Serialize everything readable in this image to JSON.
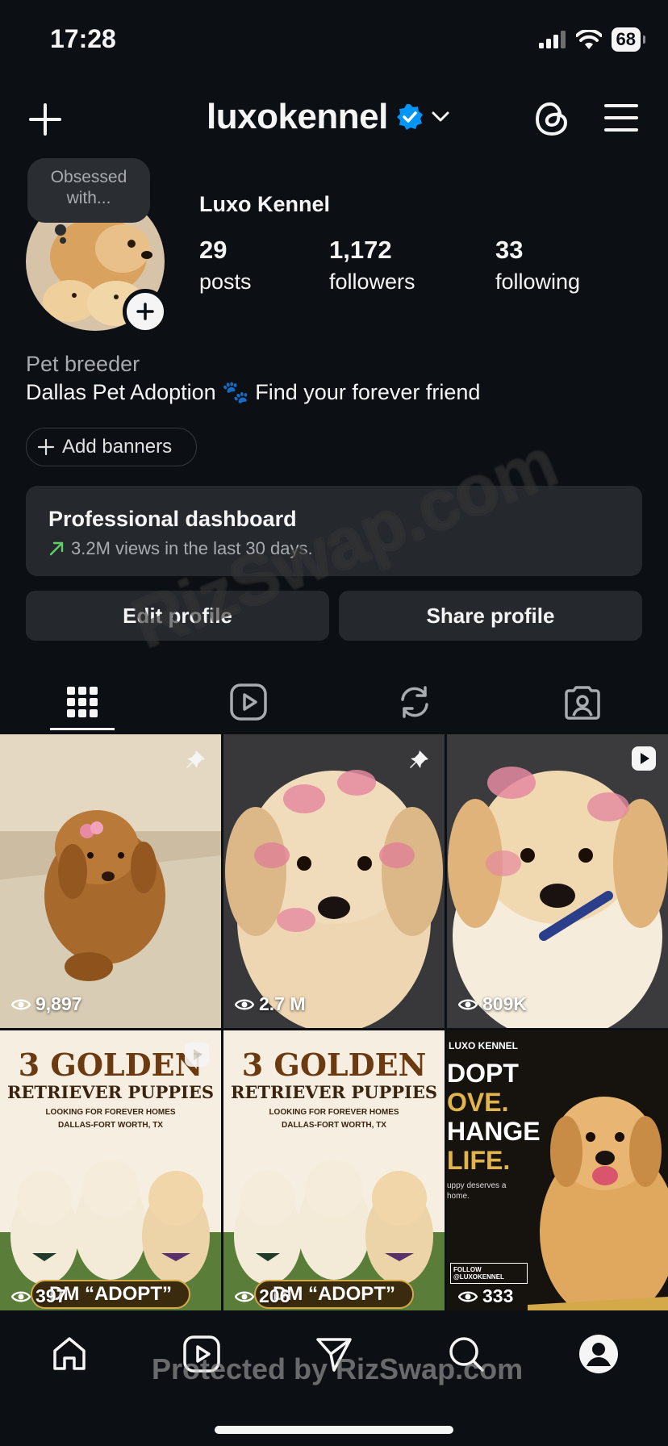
{
  "status_bar": {
    "time": "17:28",
    "battery": "68"
  },
  "header": {
    "username": "luxokennel"
  },
  "profile": {
    "note": "Obsessed with...",
    "display_name": "Luxo Kennel",
    "stats": [
      {
        "value": "29",
        "label": "posts"
      },
      {
        "value": "1,172",
        "label": "followers"
      },
      {
        "value": "33",
        "label": "following"
      }
    ],
    "category": "Pet breeder",
    "bio": "Dallas Pet Adoption 🐾 Find your forever friend",
    "add_banners": "Add banners"
  },
  "dashboard": {
    "title": "Professional dashboard",
    "subtitle": "3.2M views in the last 30 days."
  },
  "actions": {
    "edit_profile": "Edit profile",
    "share_profile": "Share profile"
  },
  "grid": {
    "posts": [
      {
        "views": "9,897",
        "badge": "pin-icon"
      },
      {
        "views": "2.7 M",
        "badge": "pin-icon"
      },
      {
        "views": "809K",
        "badge": "reel-icon"
      },
      {
        "views": "397",
        "badge": "reel-icon",
        "poster_title": "3 GOLDEN",
        "poster_subtitle": "RETRIEVER PUPPIES",
        "poster_line1": "LOOKING FOR FOREVER HOMES",
        "poster_line2": "DALLAS-FORT WORTH, TX",
        "poster_cta": "DM “ADOPT”"
      },
      {
        "views": "206",
        "poster_title": "3 GOLDEN",
        "poster_subtitle": "RETRIEVER PUPPIES",
        "poster_line1": "LOOKING FOR FOREVER HOMES",
        "poster_line2": "DALLAS-FORT WORTH, TX",
        "poster_cta": "DM “ADOPT”"
      },
      {
        "views": "333",
        "poster_brand": "LUXO KENNEL",
        "poster_lines": [
          "DOPT",
          "OVE.",
          "HANGE",
          "LIFE."
        ],
        "poster_small": "uppy deserves a home.",
        "poster_follow": "FOLLOW @LUXOKENNEL"
      }
    ]
  },
  "watermarks": {
    "diagonal": "RizSwap.com",
    "bottom": "Protected by RizSwap.com"
  },
  "colors": {
    "background": "#0c1014",
    "card": "#25292e",
    "verified": "#0095f6",
    "trend_up": "#5fd068"
  }
}
